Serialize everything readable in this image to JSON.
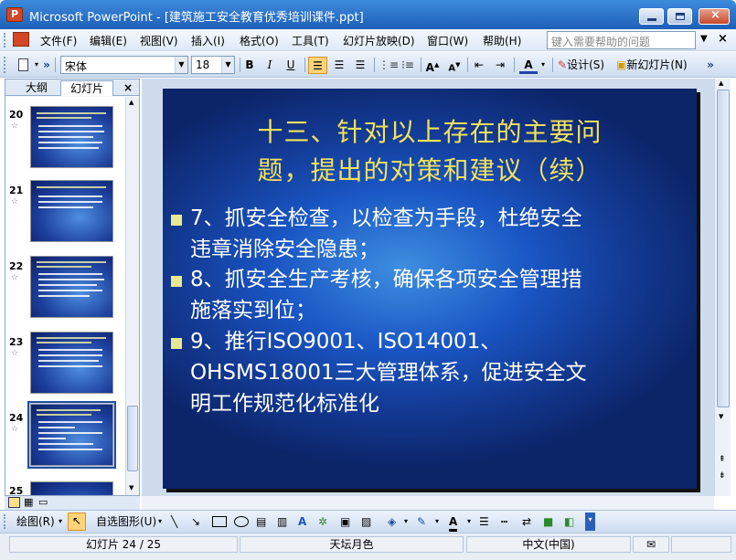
{
  "window": {
    "title": "Microsoft PowerPoint - [建筑施工安全教育优秀培训课件.ppt]",
    "app_icon": "P"
  },
  "menu": {
    "items": [
      "文件(F)",
      "编辑(E)",
      "视图(V)",
      "插入(I)",
      "格式(O)",
      "工具(T)",
      "幻灯片放映(D)",
      "窗口(W)",
      "帮助(H)"
    ],
    "help_placeholder": "键入需要帮助的问题"
  },
  "toolbar": {
    "font": "宋体",
    "size": "18",
    "bold": "B",
    "italic": "I",
    "underline": "U",
    "design": "设计(S)",
    "new_slide": "新幻灯片(N)"
  },
  "panel": {
    "tabs": [
      "大纲",
      "幻灯片"
    ],
    "thumbs": [
      "20",
      "21",
      "22",
      "23",
      "24",
      "25"
    ],
    "selected": "24"
  },
  "slide": {
    "title_line1": "十三、针对以上存在的主要问",
    "title_line2": "题，提出的对策和建议（续）",
    "bullets": [
      {
        "line1": "7、抓安全检查，以检查为手段，杜绝安全",
        "line2": "违章消除安全隐患；"
      },
      {
        "line1": "8、抓安全生产考核，确保各项安全管理措",
        "line2": "施落实到位；"
      },
      {
        "line1": "9、推行ISO9001、ISO14001、",
        "line2": "OHSMS18001三大管理体系，促进安全文",
        "line3": "明工作规范化标准化"
      }
    ]
  },
  "drawbar": {
    "draw": "绘图(R)",
    "autoshape": "自选图形(U)"
  },
  "status": {
    "slide": "幻灯片 24 / 25",
    "design": "天坛月色",
    "lang": "中文(中国)"
  },
  "colors": {
    "title_yellow": "#f2e25a",
    "slide_blue": "#1a56c4",
    "chrome_blue": "#1e5fb8"
  }
}
